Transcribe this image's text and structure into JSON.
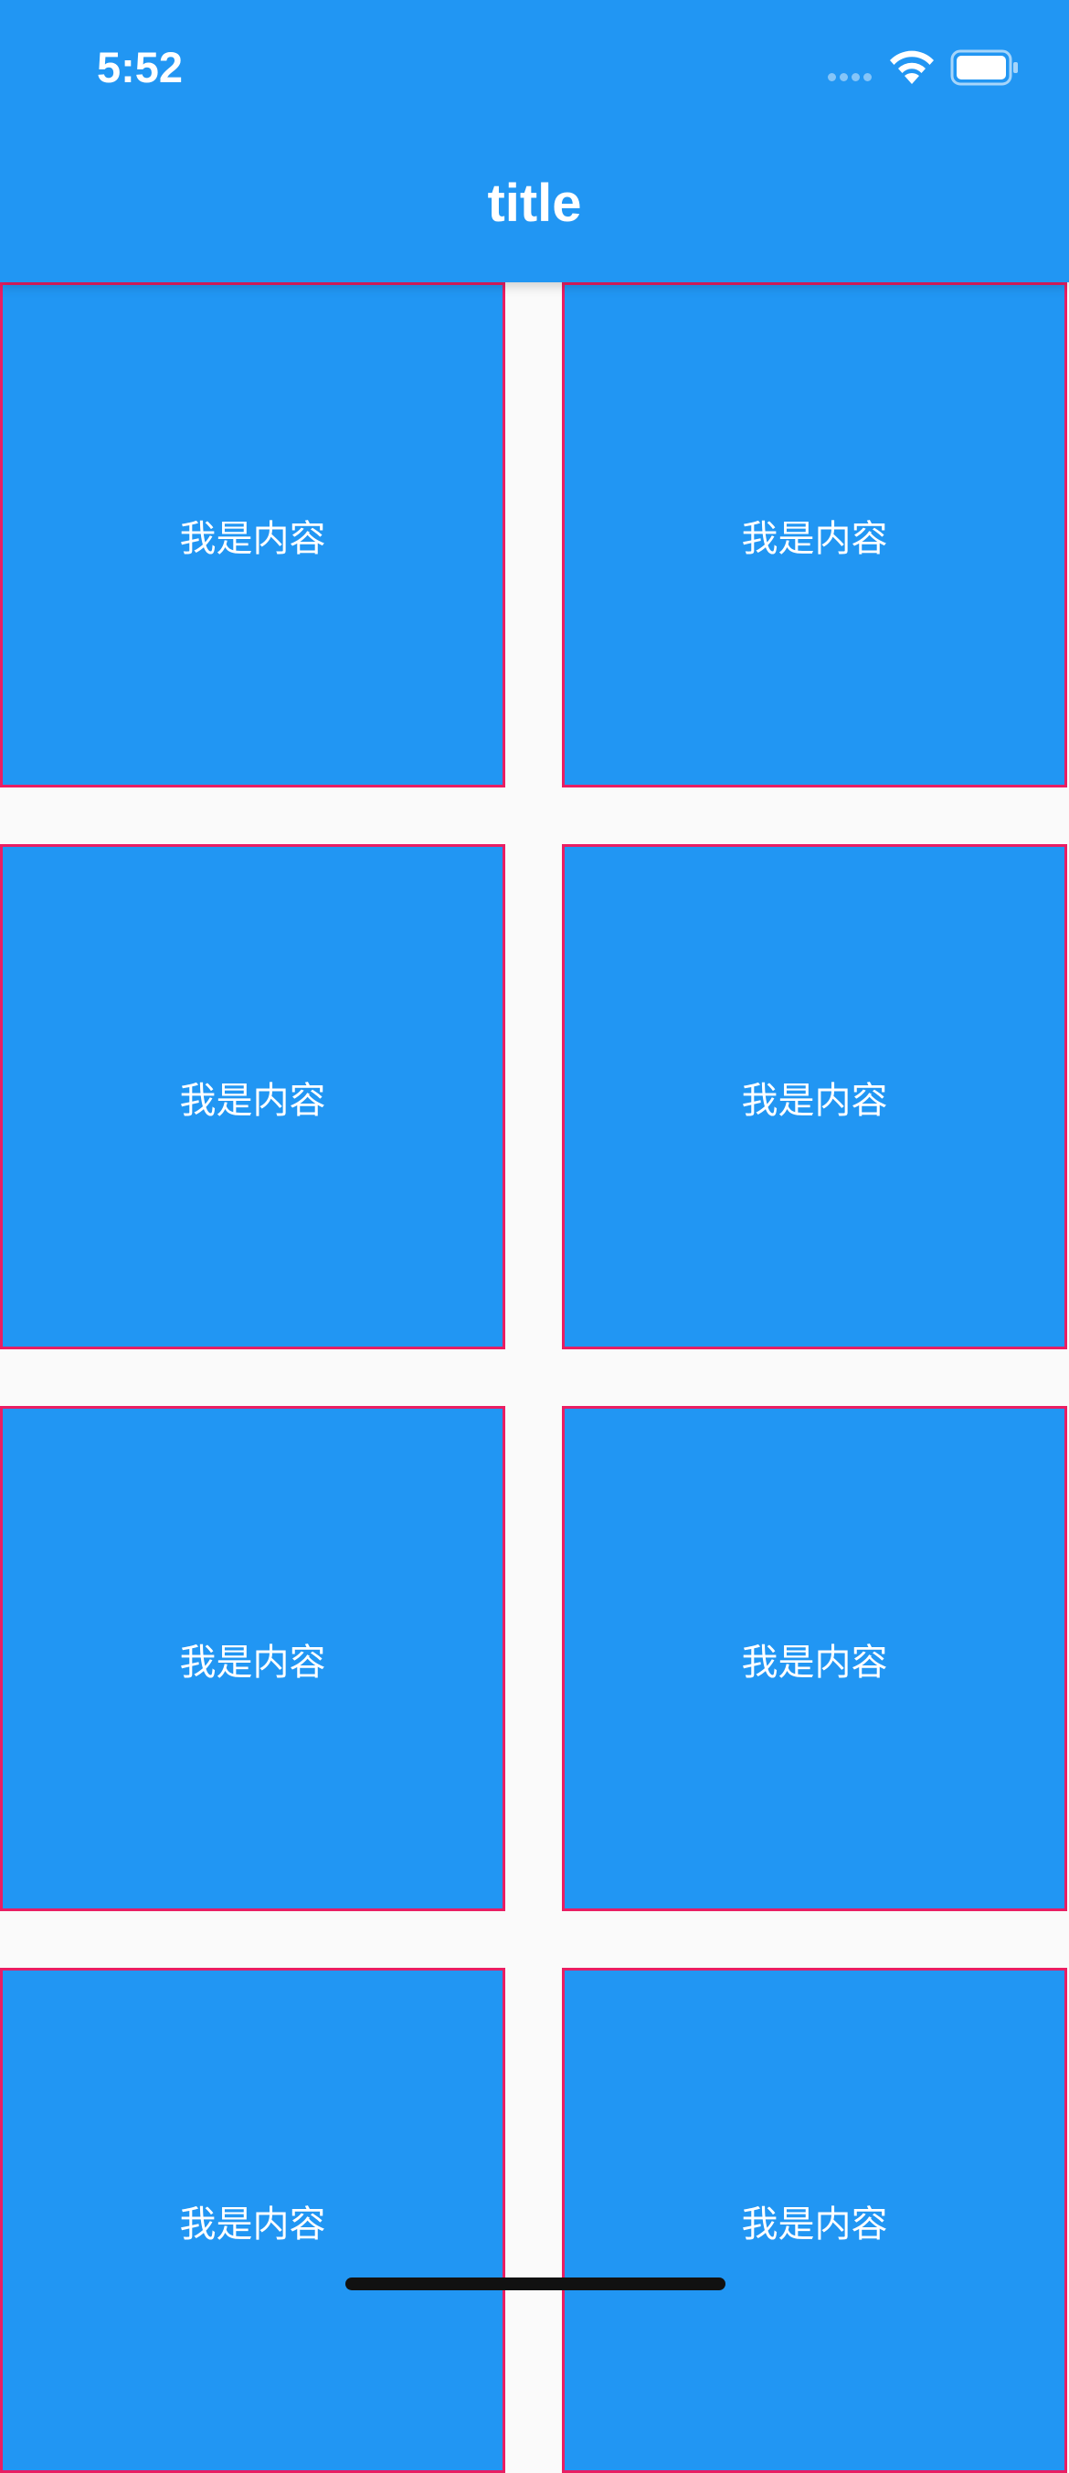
{
  "status_bar": {
    "time": "5:52"
  },
  "app_bar": {
    "title": "title",
    "background_color": "#2196f3"
  },
  "grid": {
    "cell_color": "#2196f3",
    "border_color": "#e91e63",
    "items": [
      {
        "label": "我是内容"
      },
      {
        "label": "我是内容"
      },
      {
        "label": "我是内容"
      },
      {
        "label": "我是内容"
      },
      {
        "label": "我是内容"
      },
      {
        "label": "我是内容"
      },
      {
        "label": "我是内容"
      },
      {
        "label": "我是内容"
      }
    ]
  },
  "icons": {
    "wifi": "wifi-icon",
    "battery": "battery-icon",
    "signal": "signal-icon"
  }
}
